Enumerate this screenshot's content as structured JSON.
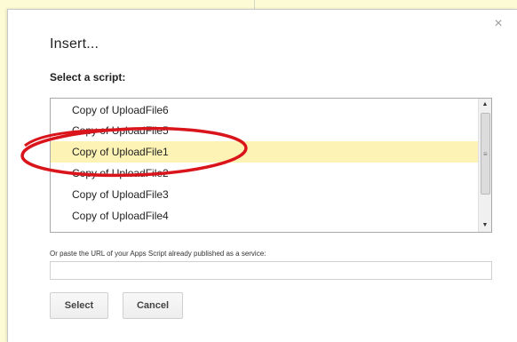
{
  "dialog": {
    "title": "Insert...",
    "close_glyph": "×",
    "subtitle": "Select a script:",
    "scripts": [
      {
        "label": "Copy of UploadFile6",
        "selected": false
      },
      {
        "label": "Copy of UploadFile5",
        "selected": false
      },
      {
        "label": "Copy of UploadFile1",
        "selected": true
      },
      {
        "label": "Copy of UploadFile2",
        "selected": false
      },
      {
        "label": "Copy of UploadFile3",
        "selected": false
      },
      {
        "label": "Copy of UploadFile4",
        "selected": false
      }
    ],
    "url_label": "Or paste the URL of your Apps Script already published as a service:",
    "url_value": "",
    "url_placeholder": "",
    "select_button": "Select",
    "cancel_button": "Cancel"
  },
  "icons": {
    "close": "close-icon",
    "scroll_up": "chevron-up-icon",
    "scroll_down": "chevron-down-icon"
  },
  "colors": {
    "page_background": "#fdfbd5",
    "selected_row": "#fdf3b5",
    "annotation": "#d9141b"
  }
}
